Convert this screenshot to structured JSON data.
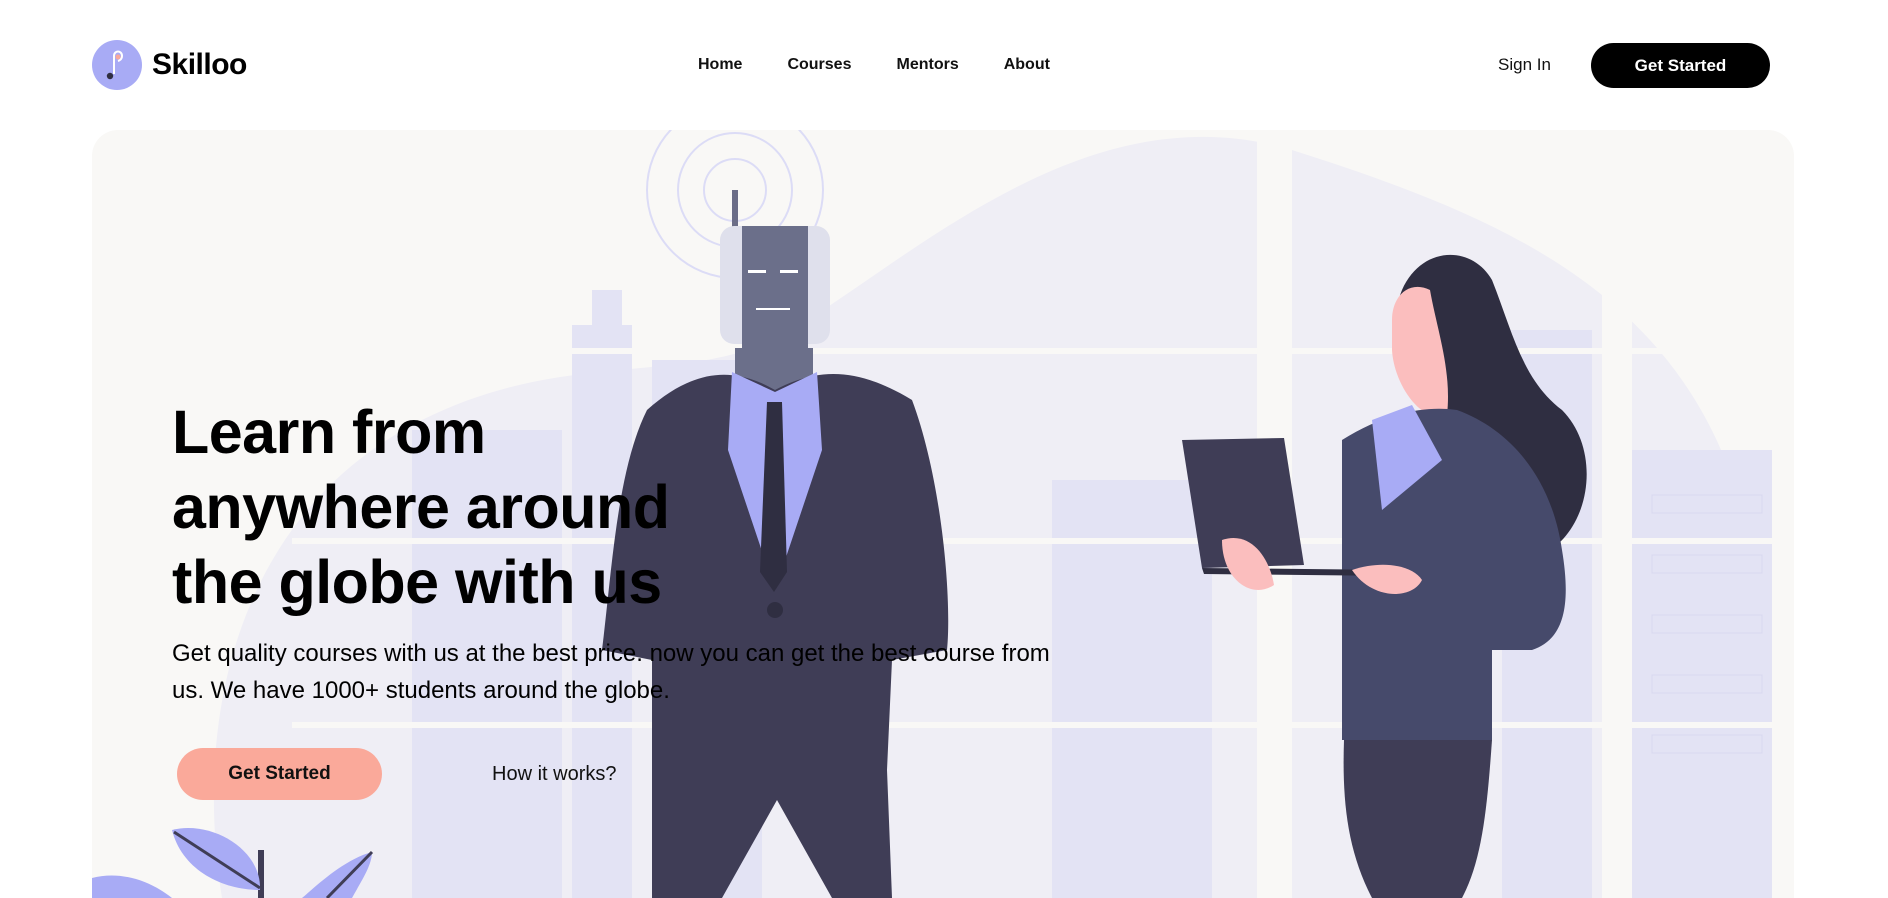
{
  "brand": {
    "name": "Skilloo",
    "logo_icon": "music-note-icon",
    "logo_color": "#a8abf5"
  },
  "nav": {
    "items": [
      {
        "label": "Home"
      },
      {
        "label": "Courses"
      },
      {
        "label": "Mentors"
      },
      {
        "label": "About"
      }
    ],
    "sign_in": "Sign In",
    "cta": "Get Started"
  },
  "hero": {
    "headline": "Learn from anywhere around the globe with us",
    "subtext": "Get quality courses with us at the best price. now you can get the best course from us. We have 1000+ students around the globe.",
    "cta": "Get Started",
    "secondary_link": "How it works?",
    "illustration": "robot-and-woman-with-laptop-illustration"
  },
  "colors": {
    "accent_lavender": "#a8abf5",
    "cta_coral": "#faa99a",
    "hero_background": "#f9f8f6",
    "dark_navy": "#3f3d56"
  }
}
